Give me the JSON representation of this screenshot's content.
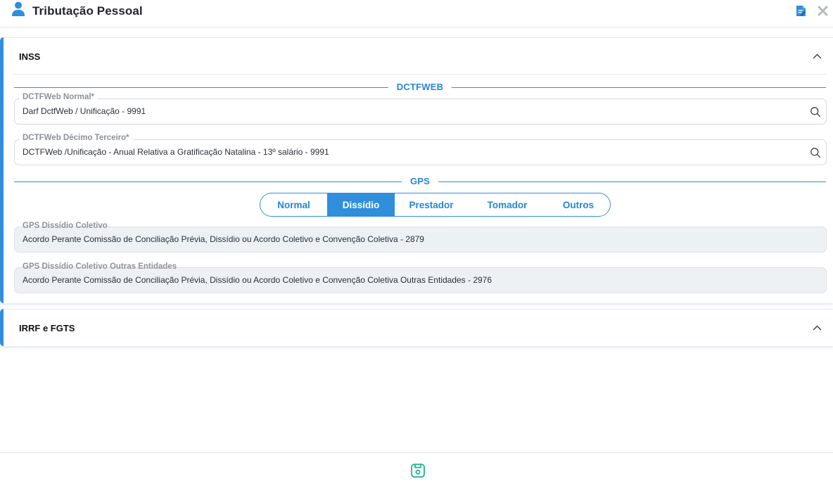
{
  "header": {
    "title": "Tributação Pessoal",
    "icons": [
      "user-icon",
      "document-edit-icon",
      "close-icon"
    ]
  },
  "inss": {
    "title": "INSS",
    "dctfweb_section": "DCTFWEB",
    "fields": [
      {
        "label": "DCTFWeb Normal*",
        "value": "Darf DctfWeb / Unificação - 9991"
      },
      {
        "label": "DCTFWeb Décimo Terceiro*",
        "value": "DCTFWeb /Unificação - Anual Relativa a Gratificação Natalina - 13º salário - 9991"
      }
    ],
    "gps_section": "GPS",
    "tabs": [
      {
        "label": "Normal",
        "active": false
      },
      {
        "label": "Dissídio",
        "active": true
      },
      {
        "label": "Prestador",
        "active": false
      },
      {
        "label": "Tomador",
        "active": false
      },
      {
        "label": "Outros",
        "active": false
      }
    ],
    "gps_fields": [
      {
        "label": "GPS Dissídio Coletivo",
        "value": "Acordo Perante Comissão de Conciliação Prévia, Dissídio ou Acordo Coletivo e Convenção Coletiva - 2879"
      },
      {
        "label": "GPS Dissídio Coletivo Outras Entidades",
        "value": "Acordo Perante Comissão de Conciliação Prévia, Dissídio ou Acordo Coletivo e Convenção Coletiva Outras Entidades - 2976"
      }
    ]
  },
  "irrf": {
    "title": "IRRF e FGTS"
  },
  "colors": {
    "accent": "#2f8fdc",
    "save": "#1fb58f"
  }
}
